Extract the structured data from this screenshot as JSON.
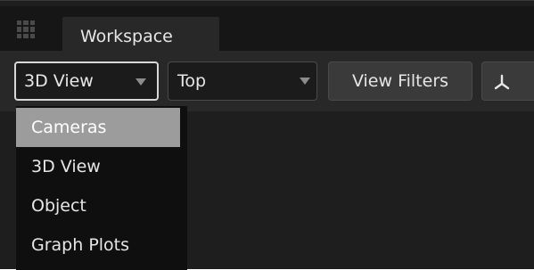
{
  "tabs": [
    {
      "label": "Workspace"
    }
  ],
  "toolbar": {
    "view_mode": {
      "selected": "3D View"
    },
    "camera": {
      "selected": "Top"
    },
    "view_filters_label": "View Filters",
    "axis_button_icon": "axis-triad-icon"
  },
  "menu": {
    "items": [
      {
        "label": "Cameras",
        "highlighted": true
      },
      {
        "label": "3D View",
        "highlighted": false
      },
      {
        "label": "Object",
        "highlighted": false
      },
      {
        "label": "Graph Plots",
        "highlighted": false
      }
    ]
  },
  "colors": {
    "background": "#1e1e1e",
    "toolbar": "#282828",
    "highlight": "#9c9c9c",
    "text": "#e6e6e6"
  }
}
